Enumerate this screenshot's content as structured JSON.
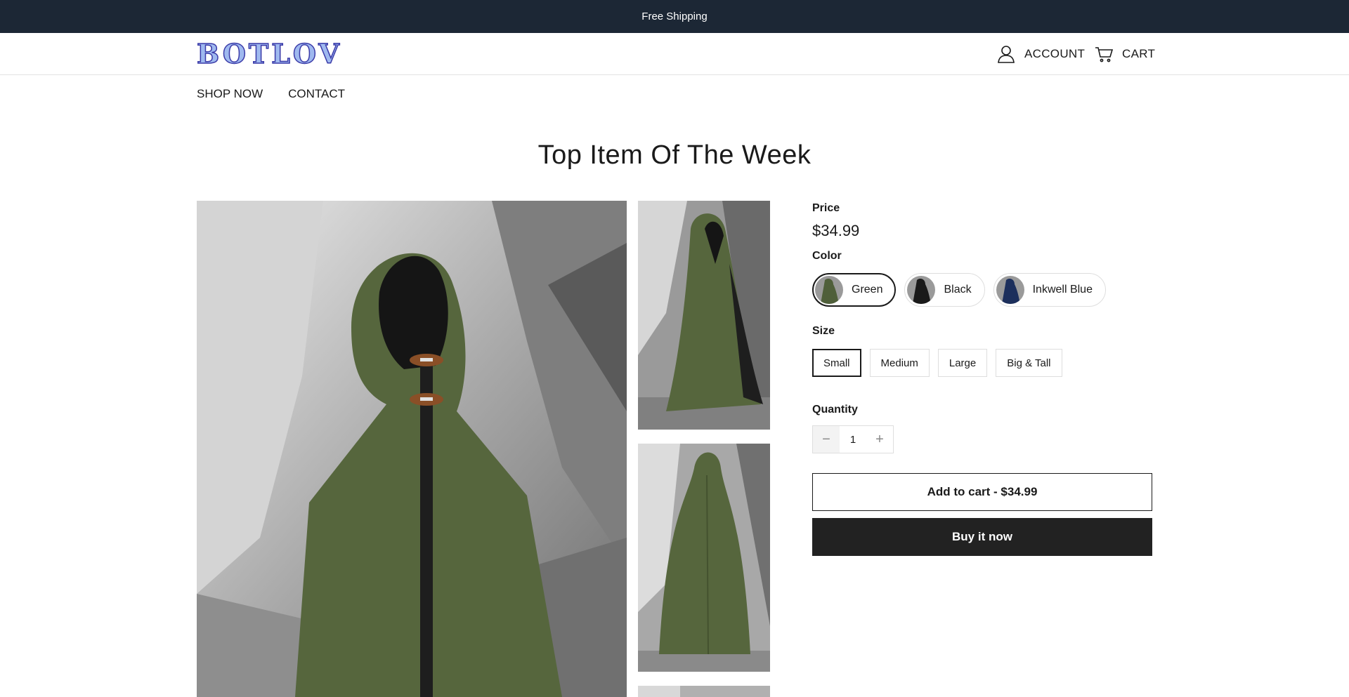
{
  "announcement": "Free Shipping",
  "header": {
    "logo_text": "BOTLOV",
    "account_label": "ACCOUNT",
    "cart_label": "CART"
  },
  "nav": [
    "SHOP NOW",
    "CONTACT"
  ],
  "section_title": "Top Item Of The Week",
  "product": {
    "price_label": "Price",
    "price": "$34.99",
    "color_label": "Color",
    "colors": [
      {
        "name": "Green",
        "swatch": "#4f5f3a",
        "selected": true
      },
      {
        "name": "Black",
        "swatch": "#1a1a1a",
        "selected": false
      },
      {
        "name": "Inkwell Blue",
        "swatch": "#1c2f5c",
        "selected": false
      }
    ],
    "size_label": "Size",
    "sizes": [
      {
        "name": "Small",
        "selected": true
      },
      {
        "name": "Medium",
        "selected": false
      },
      {
        "name": "Large",
        "selected": false
      },
      {
        "name": "Big & Tall",
        "selected": false
      }
    ],
    "quantity_label": "Quantity",
    "quantity": "1",
    "add_to_cart": "Add to cart - $34.99",
    "buy_now": "Buy it now"
  },
  "colors": {
    "announcement_bg": "#1c2735",
    "buy_button_bg": "#222222",
    "cloak_green": "#56663d"
  }
}
